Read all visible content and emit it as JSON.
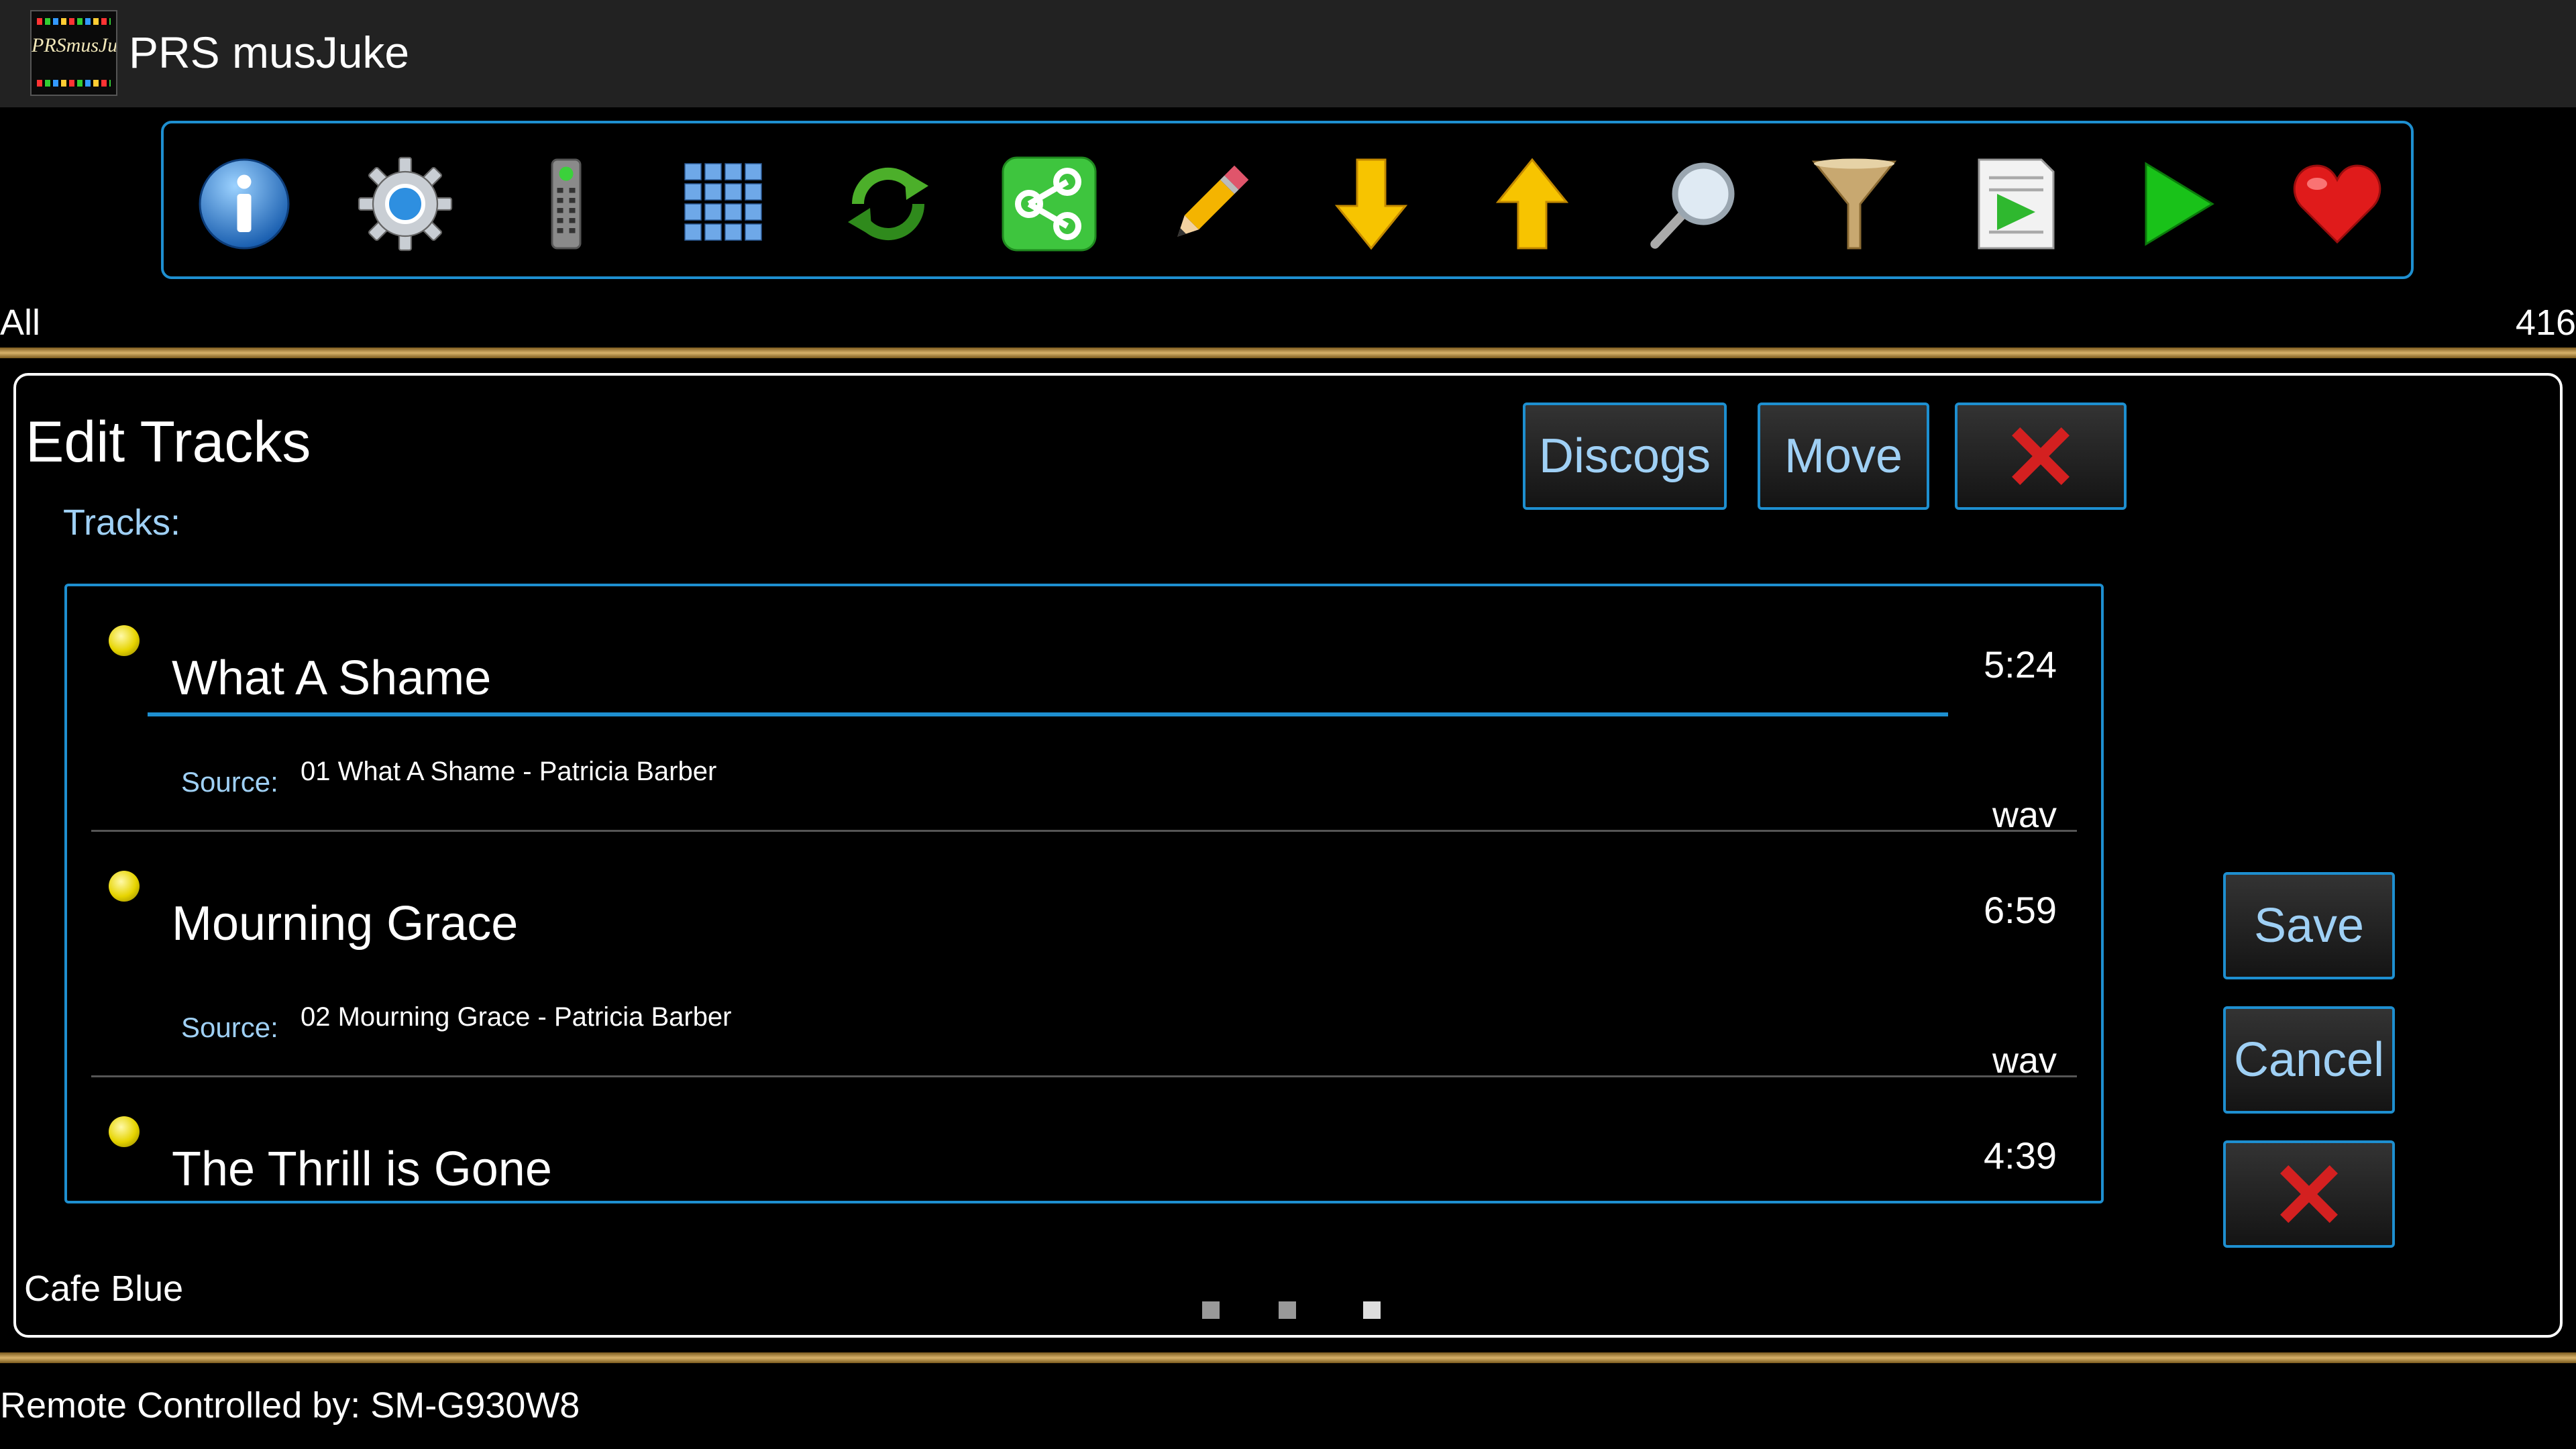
{
  "app": {
    "title": "PRS musJuke",
    "logo_text": "PRSmusJuke"
  },
  "toolbar": {
    "buttons": [
      {
        "name": "info-icon"
      },
      {
        "name": "gear-icon"
      },
      {
        "name": "remote-icon"
      },
      {
        "name": "grid-icon"
      },
      {
        "name": "refresh-icon"
      },
      {
        "name": "share-icon"
      },
      {
        "name": "pencil-icon"
      },
      {
        "name": "arrow-down-icon"
      },
      {
        "name": "arrow-up-icon"
      },
      {
        "name": "search-icon"
      },
      {
        "name": "filter-icon"
      },
      {
        "name": "playlist-icon"
      },
      {
        "name": "play-icon"
      },
      {
        "name": "heart-icon"
      }
    ]
  },
  "status": {
    "filter": "All",
    "count": "416"
  },
  "editor": {
    "title": "Edit Tracks",
    "tracks_label": "Tracks:",
    "discogs_label": "Discogs",
    "move_label": "Move",
    "save_label": "Save",
    "cancel_label": "Cancel",
    "tracks": [
      {
        "name": "What A Shame",
        "duration": "5:24",
        "source_label": "Source:",
        "source": "01 What A Shame - Patricia Barber",
        "format": "wav"
      },
      {
        "name": "Mourning Grace",
        "duration": "6:59",
        "source_label": "Source:",
        "source": "02 Mourning Grace - Patricia Barber",
        "format": "wav"
      },
      {
        "name": "The Thrill is Gone",
        "duration": "4:39"
      }
    ],
    "album": "Cafe Blue"
  },
  "footer": {
    "remote_text": "Remote Controlled by: SM-G930W8"
  },
  "colors": {
    "accent": "#1e8fd0",
    "label_blue": "#9fd0f5",
    "gold": "#d8b26a"
  }
}
